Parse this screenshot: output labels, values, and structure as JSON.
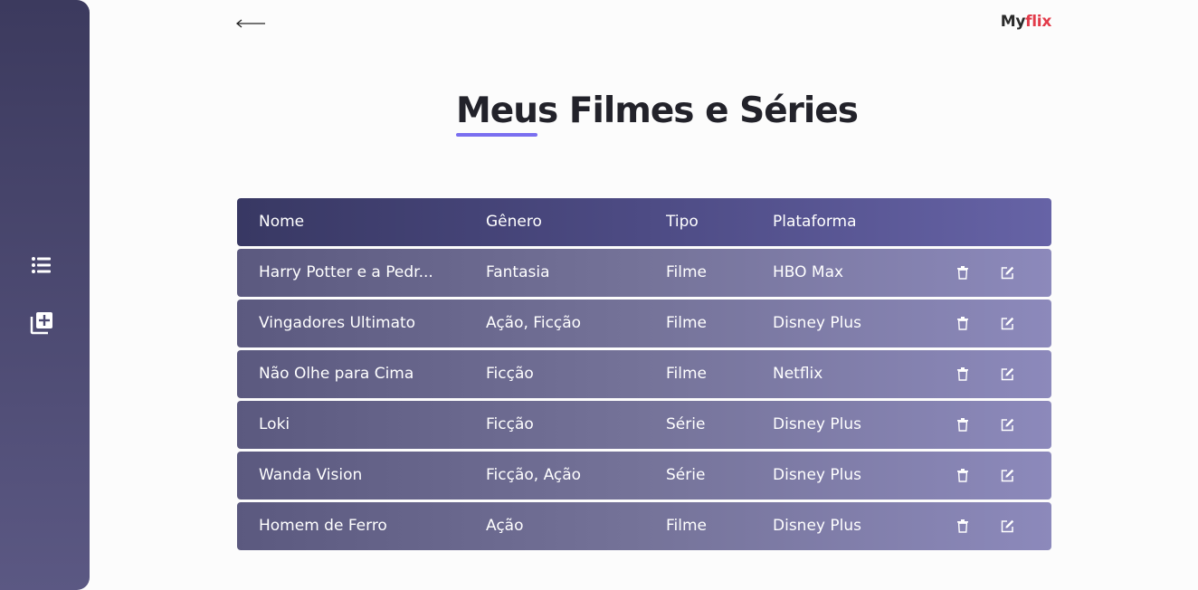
{
  "brand": {
    "prefix": "My",
    "accent": "flix"
  },
  "page": {
    "title": "Meus Filmes e Séries"
  },
  "sidebar": {
    "items": [
      {
        "icon": "list-icon"
      },
      {
        "icon": "add-library-icon"
      }
    ]
  },
  "table": {
    "headers": {
      "name": "Nome",
      "genre": "Gênero",
      "type": "Tipo",
      "platform": "Plataforma"
    },
    "rows": [
      {
        "name": "Harry Potter e a Pedr...",
        "genre": "Fantasia",
        "type": "Filme",
        "platform": "HBO Max"
      },
      {
        "name": "Vingadores Ultimato",
        "genre": "Ação, Ficção",
        "type": "Filme",
        "platform": "Disney Plus"
      },
      {
        "name": "Não Olhe para Cima",
        "genre": "Ficção",
        "type": "Filme",
        "platform": "Netflix"
      },
      {
        "name": "Loki",
        "genre": "Ficção",
        "type": "Série",
        "platform": "Disney Plus"
      },
      {
        "name": "Wanda Vision",
        "genre": "Ficção, Ação",
        "type": "Série",
        "platform": "Disney Plus"
      },
      {
        "name": "Homem de Ferro",
        "genre": "Ação",
        "type": "Filme",
        "platform": "Disney Plus"
      }
    ]
  },
  "colors": {
    "brand_accent": "#e23b4a",
    "title_underline": "#7a6ff0",
    "sidebar": "#3c3a5e"
  }
}
